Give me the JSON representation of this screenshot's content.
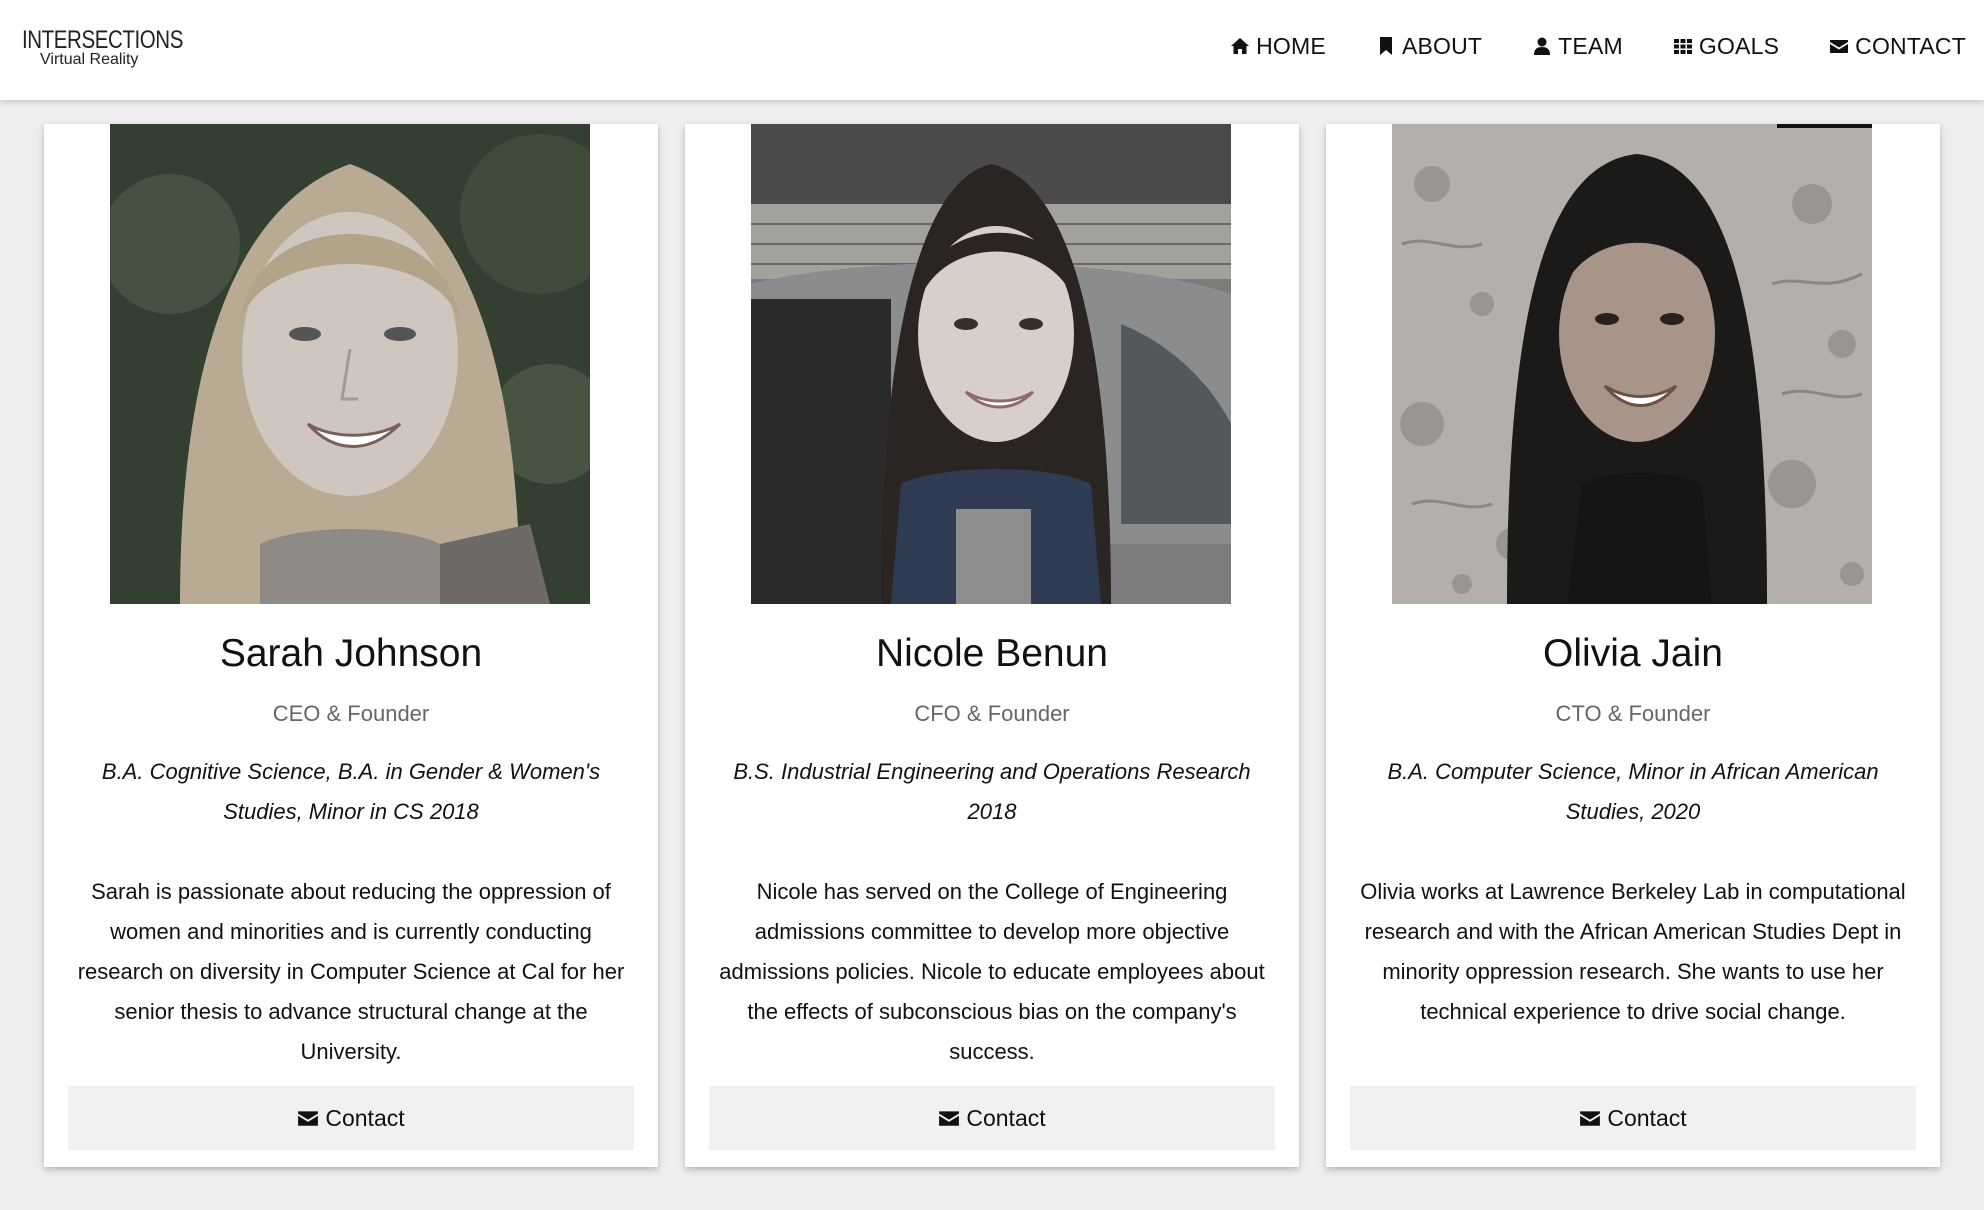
{
  "logo": {
    "main": "INTERSECTIONS",
    "sub": "Virtual Reality"
  },
  "nav": {
    "items": [
      {
        "label": "HOME",
        "icon": "home-icon"
      },
      {
        "label": "ABOUT",
        "icon": "bookmark-icon"
      },
      {
        "label": "TEAM",
        "icon": "user-icon"
      },
      {
        "label": "GOALS",
        "icon": "grid-icon"
      },
      {
        "label": "CONTACT",
        "icon": "envelope-icon"
      }
    ]
  },
  "team": [
    {
      "name": "Sarah Johnson",
      "title": "CEO & Founder",
      "degree": "B.A. Cognitive Science, B.A. in Gender & Women's Studies, Minor in CS 2018",
      "bio": "Sarah is passionate about reducing the oppression of women and minorities and is currently conducting research on diversity in Computer Science at Cal for her senior thesis to advance structural change at the University.",
      "button": "Contact"
    },
    {
      "name": "Nicole Benun",
      "title": "CFO & Founder",
      "degree": "B.S. Industrial Engineering and Operations Research 2018",
      "bio": "Nicole has served on the College of Engineering admissions committee to develop more objective admissions policies. Nicole to educate employees about the effects of subconscious bias on the company's success.",
      "button": "Contact"
    },
    {
      "name": "Olivia Jain",
      "title": "CTO & Founder",
      "degree": "B.A. Computer Science, Minor in African American Studies, 2020",
      "bio": "Olivia works at Lawrence Berkeley Lab in computational research and with the African American Studies Dept in minority oppression research. She wants to use her technical experience to drive social change.",
      "button": "Contact"
    }
  ]
}
